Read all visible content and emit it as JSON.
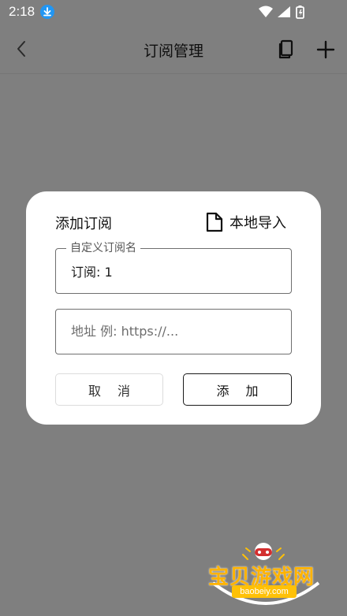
{
  "status_bar": {
    "time": "2:18",
    "icons": [
      "download-icon",
      "wifi-icon",
      "signal-icon",
      "battery-icon"
    ]
  },
  "app_bar": {
    "title": "订阅管理",
    "back_icon": "chevron-left-icon",
    "actions": [
      "book-icon",
      "plus-icon"
    ]
  },
  "dialog": {
    "title": "添加订阅",
    "local_import_label": "本地导入",
    "name_field": {
      "label": "自定义订阅名",
      "value": "订阅: 1"
    },
    "url_field": {
      "placeholder": "地址 例: https://..."
    },
    "cancel_label": "取 消",
    "add_label": "添 加"
  },
  "watermark": {
    "text": "宝贝游戏网",
    "url": "baobeiy.com"
  },
  "colors": {
    "overlay": "#7f7f7f",
    "dialog_bg": "#ffffff",
    "status_accent": "#2196f3",
    "watermark": "#ffb300"
  }
}
